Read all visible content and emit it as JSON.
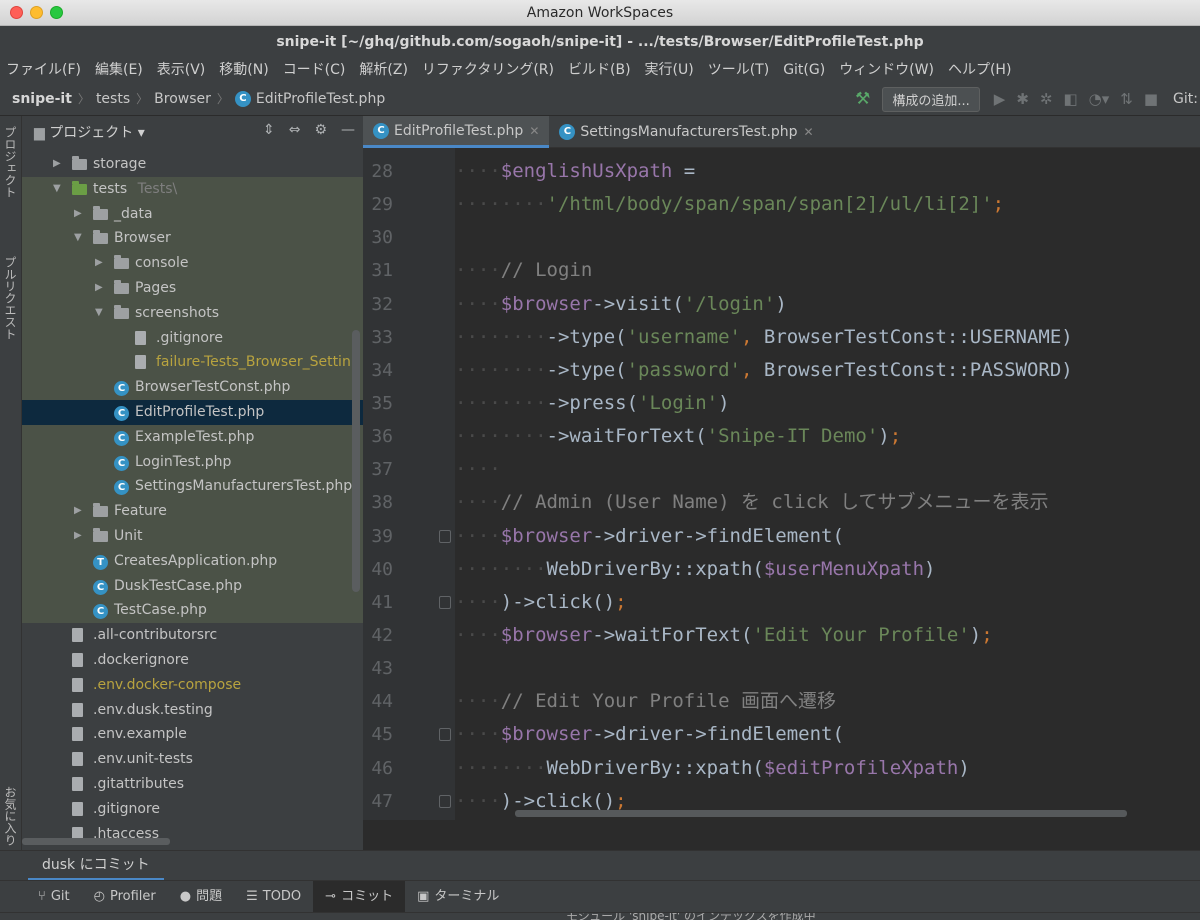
{
  "window": {
    "title": "Amazon WorkSpaces"
  },
  "ide_title": "snipe-it [~/ghq/github.com/sogaoh/snipe-it] - .../tests/Browser/EditProfileTest.php",
  "menu": [
    "ファイル(F)",
    "編集(E)",
    "表示(V)",
    "移動(N)",
    "コード(C)",
    "解析(Z)",
    "リファクタリング(R)",
    "ビルド(B)",
    "実行(U)",
    "ツール(T)",
    "Git(G)",
    "ウィンドウ(W)",
    "ヘルプ(H)"
  ],
  "breadcrumb": {
    "root": "snipe-it",
    "c1": "tests",
    "c2": "Browser",
    "file": "EditProfileTest.php"
  },
  "toolbar": {
    "config_label": "構成の追加...",
    "git_label": "Git:"
  },
  "left_strip": {
    "project": "プロジェクト",
    "pull_requests": "プルリクエスト",
    "favorites": "お気に入り"
  },
  "project_panel": {
    "title": "プロジェクト",
    "items": [
      {
        "label": "storage",
        "type": "folder",
        "depth": 1,
        "arrow": "right"
      },
      {
        "label": "tests",
        "suffix": "Tests\\",
        "type": "folder-green",
        "depth": 1,
        "arrow": "down",
        "tint": true
      },
      {
        "label": "_data",
        "type": "folder",
        "depth": 2,
        "arrow": "right",
        "tint": true
      },
      {
        "label": "Browser",
        "type": "folder",
        "depth": 2,
        "arrow": "down",
        "tint": true
      },
      {
        "label": "console",
        "type": "folder",
        "depth": 3,
        "arrow": "right",
        "tint": true
      },
      {
        "label": "Pages",
        "type": "folder",
        "depth": 3,
        "arrow": "right",
        "tint": true
      },
      {
        "label": "screenshots",
        "type": "folder",
        "depth": 3,
        "arrow": "down",
        "tint": true
      },
      {
        "label": ".gitignore",
        "type": "file",
        "depth": 4,
        "tint": true
      },
      {
        "label": "failure-Tests_Browser_Settin",
        "type": "file",
        "depth": 4,
        "tint": true,
        "yellow": true
      },
      {
        "label": "BrowserTestConst.php",
        "type": "php",
        "depth": 3,
        "tint": true
      },
      {
        "label": "EditProfileTest.php",
        "type": "php",
        "depth": 3,
        "selected": true
      },
      {
        "label": "ExampleTest.php",
        "type": "php",
        "depth": 3,
        "tint": true
      },
      {
        "label": "LoginTest.php",
        "type": "php",
        "depth": 3,
        "tint": true
      },
      {
        "label": "SettingsManufacturersTest.php",
        "type": "php",
        "depth": 3,
        "tint": true
      },
      {
        "label": "Feature",
        "type": "folder",
        "depth": 2,
        "arrow": "right",
        "tint": true
      },
      {
        "label": "Unit",
        "type": "folder",
        "depth": 2,
        "arrow": "right",
        "tint": true
      },
      {
        "label": "CreatesApplication.php",
        "type": "php-t",
        "depth": 2,
        "tint": true
      },
      {
        "label": "DuskTestCase.php",
        "type": "php",
        "depth": 2,
        "tint": true
      },
      {
        "label": "TestCase.php",
        "type": "php",
        "depth": 2,
        "tint": true
      },
      {
        "label": ".all-contributorsrc",
        "type": "file",
        "depth": 1
      },
      {
        "label": ".dockerignore",
        "type": "file",
        "depth": 1
      },
      {
        "label": ".env.docker-compose",
        "type": "file",
        "depth": 1,
        "yellow": true
      },
      {
        "label": ".env.dusk.testing",
        "type": "file",
        "depth": 1
      },
      {
        "label": ".env.example",
        "type": "file",
        "depth": 1
      },
      {
        "label": ".env.unit-tests",
        "type": "file",
        "depth": 1
      },
      {
        "label": ".gitattributes",
        "type": "file",
        "depth": 1
      },
      {
        "label": ".gitignore",
        "type": "file",
        "depth": 1
      },
      {
        "label": ".htaccess",
        "type": "file",
        "depth": 1
      }
    ]
  },
  "editor_tabs": [
    {
      "label": "EditProfileTest.php",
      "active": true
    },
    {
      "label": "SettingsManufacturersTest.php",
      "active": false
    }
  ],
  "code": [
    {
      "n": "28",
      "indent": 1,
      "parts": [
        [
          "var",
          "$englishUsXpath"
        ],
        [
          "fn",
          " ="
        ]
      ]
    },
    {
      "n": "29",
      "indent": 2,
      "parts": [
        [
          "str",
          "'/html/body/span/span/span[2]/ul/li[2]'"
        ],
        [
          "punc",
          ";"
        ]
      ]
    },
    {
      "n": "30",
      "indent": 0,
      "parts": []
    },
    {
      "n": "31",
      "indent": 1,
      "parts": [
        [
          "cmt",
          "// Login"
        ]
      ]
    },
    {
      "n": "32",
      "indent": 1,
      "parts": [
        [
          "var",
          "$browser"
        ],
        [
          "fn",
          "->visit("
        ],
        [
          "str",
          "'/login'"
        ],
        [
          "fn",
          ")"
        ]
      ]
    },
    {
      "n": "33",
      "indent": 2,
      "parts": [
        [
          "fn",
          "->type("
        ],
        [
          "str",
          "'username'"
        ],
        [
          "punc",
          ", "
        ],
        [
          "fn",
          "BrowserTestConst::USERNAME)"
        ]
      ]
    },
    {
      "n": "34",
      "indent": 2,
      "parts": [
        [
          "fn",
          "->type("
        ],
        [
          "str",
          "'password'"
        ],
        [
          "punc",
          ", "
        ],
        [
          "fn",
          "BrowserTestConst::PASSWORD)"
        ]
      ]
    },
    {
      "n": "35",
      "indent": 2,
      "parts": [
        [
          "fn",
          "->press("
        ],
        [
          "str",
          "'Login'"
        ],
        [
          "fn",
          ")"
        ]
      ]
    },
    {
      "n": "36",
      "indent": 2,
      "parts": [
        [
          "fn",
          "->waitForText("
        ],
        [
          "str",
          "'Snipe-IT Demo'"
        ],
        [
          "fn",
          ")"
        ],
        [
          "punc",
          ";"
        ]
      ]
    },
    {
      "n": "37",
      "indent": 1,
      "parts": []
    },
    {
      "n": "38",
      "indent": 1,
      "parts": [
        [
          "cmt",
          "// Admin (User Name) を click してサブメニューを表示"
        ]
      ]
    },
    {
      "n": "39",
      "indent": 1,
      "fold": true,
      "parts": [
        [
          "var",
          "$browser"
        ],
        [
          "fn",
          "->driver->findElement("
        ]
      ]
    },
    {
      "n": "40",
      "indent": 2,
      "parts": [
        [
          "fn",
          "WebDriverBy::xpath("
        ],
        [
          "var",
          "$userMenuXpath"
        ],
        [
          "fn",
          ")"
        ]
      ]
    },
    {
      "n": "41",
      "indent": 1,
      "fold": true,
      "parts": [
        [
          "fn",
          ")->click()"
        ],
        [
          "punc",
          ";"
        ]
      ]
    },
    {
      "n": "42",
      "indent": 1,
      "parts": [
        [
          "var",
          "$browser"
        ],
        [
          "fn",
          "->waitForText("
        ],
        [
          "str",
          "'Edit Your Profile'"
        ],
        [
          "fn",
          ")"
        ],
        [
          "punc",
          ";"
        ]
      ]
    },
    {
      "n": "43",
      "indent": 0,
      "parts": []
    },
    {
      "n": "44",
      "indent": 1,
      "parts": [
        [
          "cmt",
          "// Edit Your Profile 画面へ遷移"
        ]
      ]
    },
    {
      "n": "45",
      "indent": 1,
      "fold": true,
      "parts": [
        [
          "var",
          "$browser"
        ],
        [
          "fn",
          "->driver->findElement("
        ]
      ]
    },
    {
      "n": "46",
      "indent": 2,
      "parts": [
        [
          "fn",
          "WebDriverBy::xpath("
        ],
        [
          "var",
          "$editProfileXpath"
        ],
        [
          "fn",
          ")"
        ]
      ]
    },
    {
      "n": "47",
      "indent": 1,
      "fold": true,
      "parts": [
        [
          "fn",
          ")->click()"
        ],
        [
          "punc",
          ";"
        ]
      ]
    }
  ],
  "commit_panel": {
    "title": "dusk にコミット"
  },
  "tool_windows": [
    {
      "label": "Git",
      "icon": "branch-icon"
    },
    {
      "label": "Profiler",
      "icon": "profiler-icon"
    },
    {
      "label": "問題",
      "icon": "problems-icon"
    },
    {
      "label": "TODO",
      "icon": "todo-icon"
    },
    {
      "label": "コミット",
      "icon": "commit-icon",
      "active": true
    },
    {
      "label": "ターミナル",
      "icon": "terminal-icon"
    }
  ],
  "status_bar": {
    "message": "モジュール 'snipe-it' のインデックスを作成中"
  }
}
